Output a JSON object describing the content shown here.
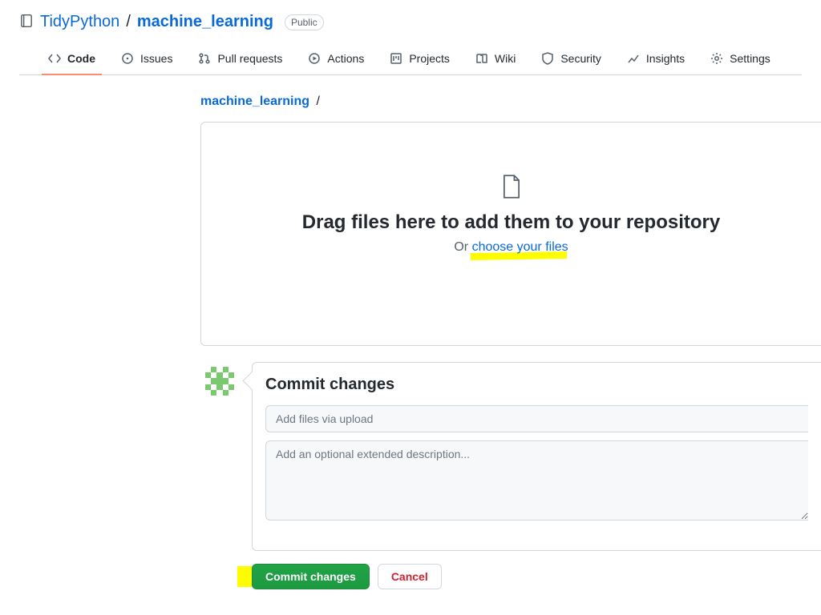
{
  "header": {
    "owner": "TidyPython",
    "separator": "/",
    "name": "machine_learning",
    "visibility": "Public"
  },
  "tabs": {
    "code": "Code",
    "issues": "Issues",
    "pulls": "Pull requests",
    "actions": "Actions",
    "projects": "Projects",
    "wiki": "Wiki",
    "security": "Security",
    "insights": "Insights",
    "settings": "Settings"
  },
  "path": {
    "repo": "machine_learning",
    "slash": "/"
  },
  "dropzone": {
    "heading": "Drag files here to add them to your repository",
    "or_prefix": "Or ",
    "choose_link": "choose your files"
  },
  "commit": {
    "heading": "Commit changes",
    "summary_placeholder": "Add files via upload",
    "description_placeholder": "Add an optional extended description..."
  },
  "buttons": {
    "commit": "Commit changes",
    "cancel": "Cancel"
  }
}
